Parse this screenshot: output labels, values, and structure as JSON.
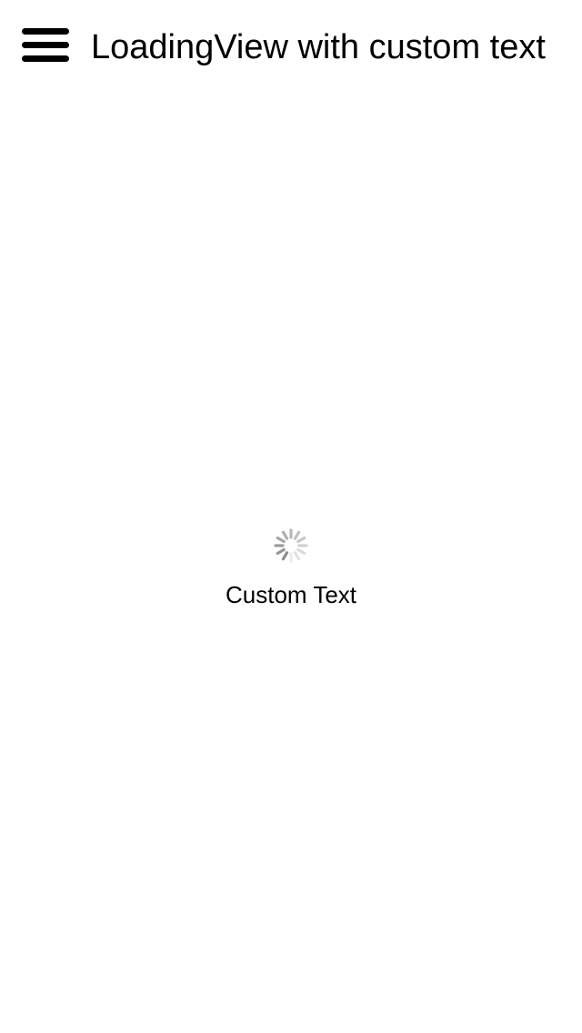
{
  "header": {
    "menu_icon": "hamburger-menu-icon",
    "title": "LoadingView with custom text"
  },
  "loading": {
    "spinner_icon": "activity-indicator-icon",
    "text": "Custom Text"
  }
}
